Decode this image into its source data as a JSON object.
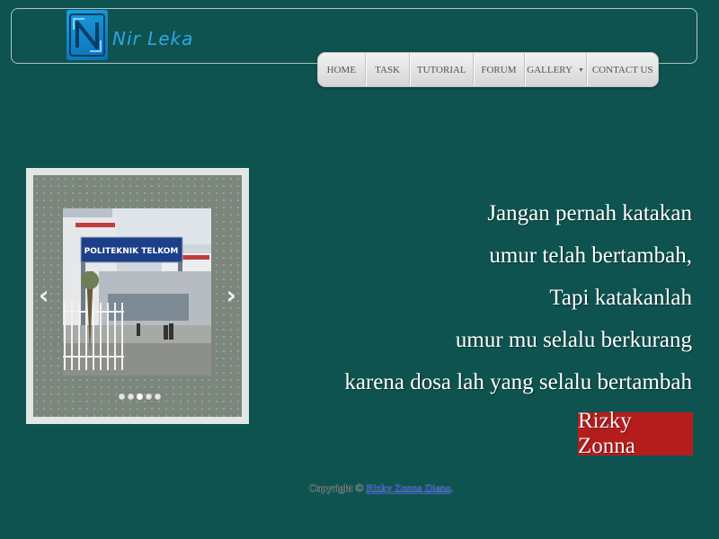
{
  "header": {
    "logo_text": "Nir Leka"
  },
  "nav": {
    "items": [
      {
        "label": "HOME"
      },
      {
        "label": "TASK"
      },
      {
        "label": "TUTORIAL"
      },
      {
        "label": "FORUM"
      },
      {
        "label": "GALLERY"
      },
      {
        "label": "CONTACT US"
      }
    ]
  },
  "slider": {
    "photo_sign": "POLITEKNIK TELKOM",
    "prev_icon": "‹",
    "next_icon": "›",
    "dot_count": 5,
    "active_dot": 3
  },
  "quote": {
    "lines": [
      "Jangan pernah katakan",
      "umur telah bertambah,",
      "Tapi katakanlah",
      "umur mu selalu berkurang",
      "karena dosa lah yang selalu bertambah"
    ],
    "author": "Rizky Zonna"
  },
  "footer": {
    "prefix": "Copyright © ",
    "link_text": "Rizky Zonna Diana",
    "suffix": "."
  },
  "colors": {
    "background": "#0e5350",
    "badge": "#b51d1d",
    "logo": "#2ea6e6"
  }
}
